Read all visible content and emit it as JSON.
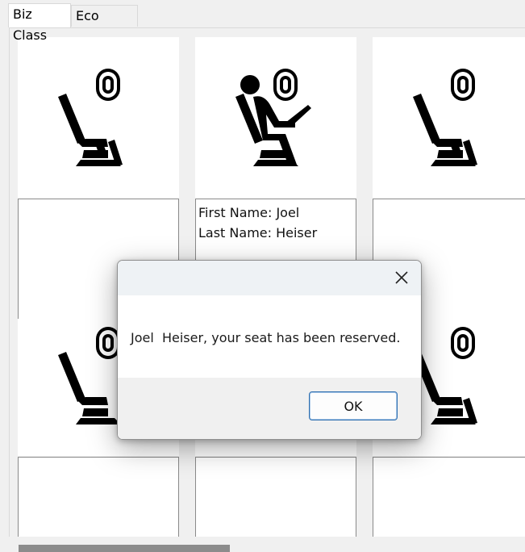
{
  "tabs": [
    {
      "label": "Biz Class",
      "active": true
    },
    {
      "label": "Eco Class",
      "active": false
    }
  ],
  "seats": [
    {
      "occupied": false,
      "first_name": "",
      "last_name": ""
    },
    {
      "occupied": true,
      "first_name": "First Name: Joel",
      "last_name": "Last Name: Heiser"
    },
    {
      "occupied": false,
      "first_name": "",
      "last_name": ""
    },
    {
      "occupied": false,
      "first_name": "",
      "last_name": ""
    },
    {
      "occupied": false,
      "first_name": "",
      "last_name": ""
    },
    {
      "occupied": false,
      "first_name": "",
      "last_name": ""
    }
  ],
  "dialog": {
    "message": "Joel  Heiser, your seat has been reserved.",
    "ok_label": "OK",
    "close_icon": "close-icon"
  },
  "icons": {
    "empty_seat": "airplane-seat-icon",
    "occupied_seat": "passenger-with-laptop-icon"
  },
  "colors": {
    "ok_border": "#2f6fb0",
    "dialog_title_bg": "#eef2f5"
  }
}
